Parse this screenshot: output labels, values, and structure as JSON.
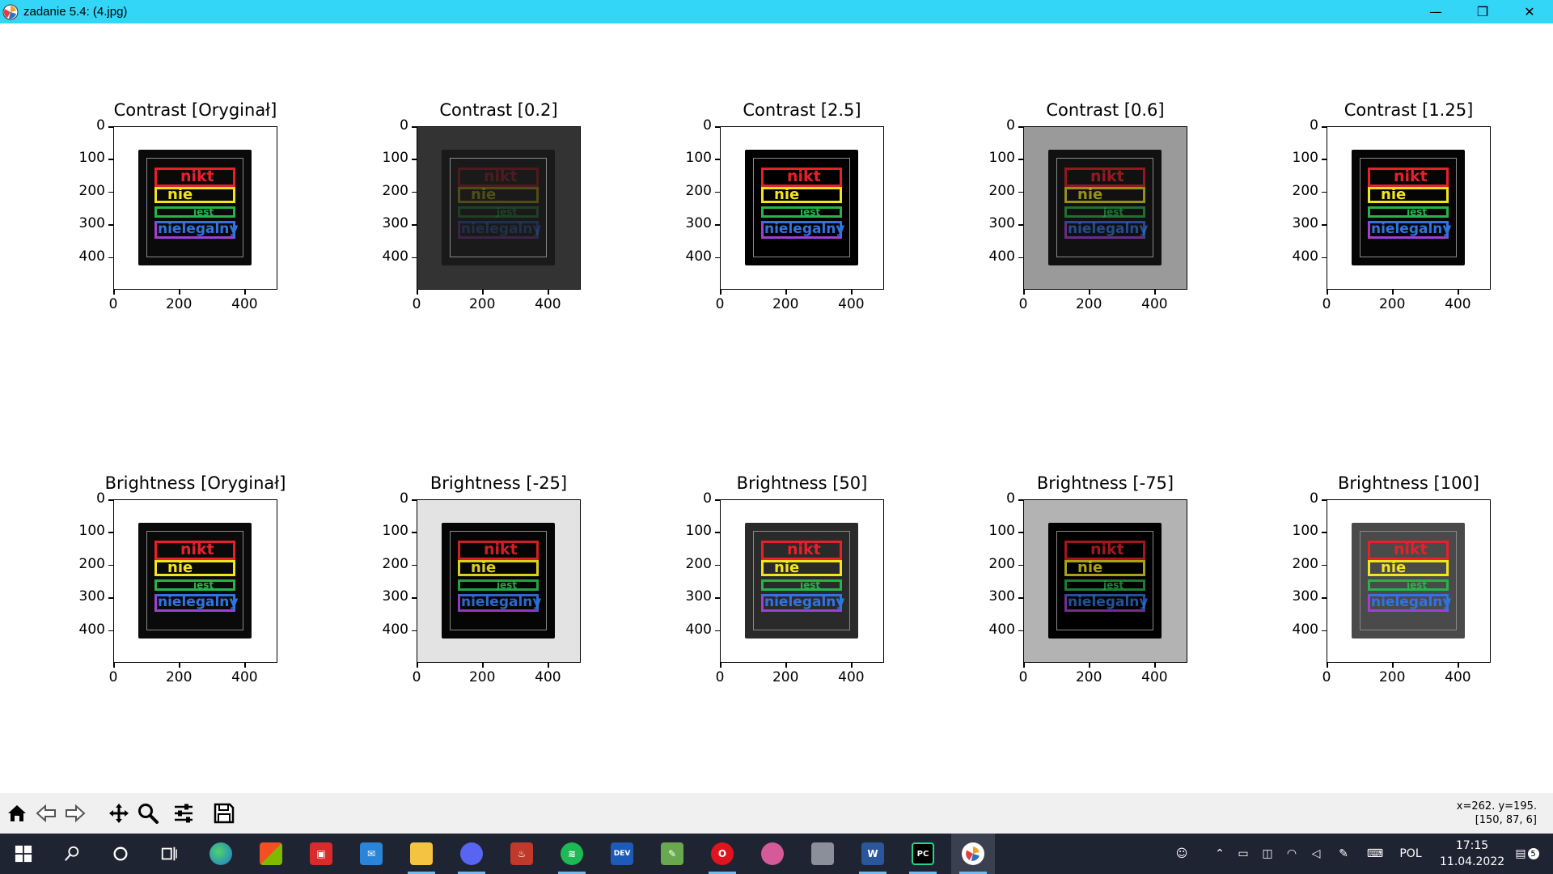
{
  "window": {
    "title": "zadanie 5.4: (4.jpg)",
    "minimize_glyph": "—",
    "restore_glyph": "❐",
    "close_glyph": "✕"
  },
  "figure": {
    "axis_ticks": {
      "y": [
        "0",
        "100",
        "200",
        "300",
        "400"
      ],
      "x": [
        "0",
        "200",
        "400"
      ]
    },
    "sticker_words": [
      "nikt",
      "nie",
      "jest",
      "nielegalny"
    ],
    "subplots_row1": [
      {
        "title": "Contrast [Oryginał]",
        "bg": "#ffffff",
        "sticker": "#0a0a0a",
        "band_opacity": 1.0
      },
      {
        "title": "Contrast [0.2]",
        "bg": "#333333",
        "sticker": "#1a1a1a",
        "band_opacity": 0.25
      },
      {
        "title": "Contrast [2.5]",
        "bg": "#ffffff",
        "sticker": "#000000",
        "band_opacity": 1.0
      },
      {
        "title": "Contrast [0.6]",
        "bg": "#9a9a9a",
        "sticker": "#111111",
        "band_opacity": 0.6
      },
      {
        "title": "Contrast [1.25]",
        "bg": "#ffffff",
        "sticker": "#050505",
        "band_opacity": 1.0
      }
    ],
    "subplots_row2": [
      {
        "title": "Brightness [Oryginał]",
        "bg": "#ffffff",
        "sticker": "#0a0a0a",
        "band_opacity": 1.0
      },
      {
        "title": "Brightness [-25]",
        "bg": "#e3e3e3",
        "sticker": "#050505",
        "band_opacity": 0.9
      },
      {
        "title": "Brightness [50]",
        "bg": "#ffffff",
        "sticker": "#2a2a2a",
        "band_opacity": 1.0
      },
      {
        "title": "Brightness [-75]",
        "bg": "#b3b3b3",
        "sticker": "#000000",
        "band_opacity": 0.7
      },
      {
        "title": "Brightness [100]",
        "bg": "#ffffff",
        "sticker": "#4a4a4a",
        "band_opacity": 1.0
      }
    ]
  },
  "toolbar": {
    "buttons": [
      "home",
      "back",
      "forward",
      "pan",
      "zoom",
      "configure-subplots",
      "save"
    ],
    "coords_line1": "x=262. y=195.",
    "coords_line2": "[150, 87, 6]"
  },
  "taskbar": {
    "tray_lang": "POL",
    "time": "17:15",
    "date": "11.04.2022",
    "notification_count": "5"
  },
  "colors": {
    "titlebar": "#33d6f6",
    "toolbar_bg": "#f0f0f0",
    "taskbar_bg": "#1f2432",
    "band_red": "#e8202a",
    "band_yellow": "#f2e51c",
    "band_green": "#27b24a",
    "band_blue": "#2f74e0",
    "band_purple": "#a040d0"
  }
}
